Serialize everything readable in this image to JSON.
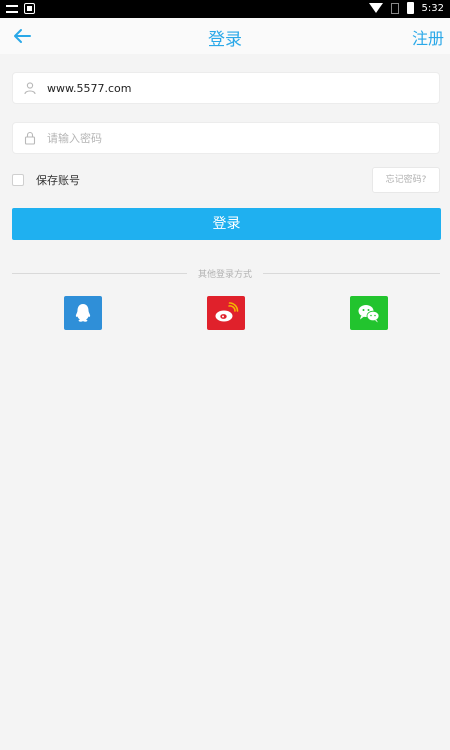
{
  "status_bar": {
    "time": "5:32"
  },
  "header": {
    "title": "登录",
    "register_label": "注册"
  },
  "form": {
    "username_value": "www.5577.com",
    "password_placeholder": "请输入密码",
    "remember_label": "保存账号",
    "forgot_label": "忘记密码?",
    "login_label": "登录"
  },
  "other_login": {
    "label": "其他登录方式",
    "providers": [
      {
        "name": "QQ",
        "icon": "qq-icon",
        "color": "#2f8fd8"
      },
      {
        "name": "Weibo",
        "icon": "weibo-icon",
        "color": "#e0212b"
      },
      {
        "name": "WeChat",
        "icon": "wechat-icon",
        "color": "#22c42e"
      }
    ]
  },
  "colors": {
    "accent": "#2aa8e8",
    "button": "#1fb0f0",
    "background": "#f4f4f4"
  }
}
